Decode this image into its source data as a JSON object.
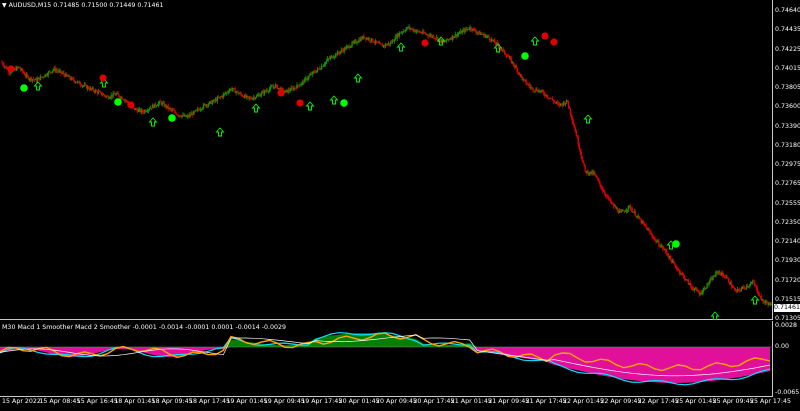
{
  "chart_title": "AUDUSD,M15  0.71485 0.71500 0.71449 0.71461",
  "indicator_title": "M30 Macd 1 Smoother Macd 2 Smoother -0.0001 -0.0014 -0.0001 0.0001 -0.0014 -0.0029",
  "price_axis": [
    "0.74640",
    "0.74435",
    "0.74225",
    "0.74015",
    "0.73805",
    "0.73600",
    "0.73390",
    "0.73180",
    "0.72975",
    "0.72765",
    "0.72555",
    "0.72350",
    "0.72140",
    "0.71930",
    "0.71720",
    "0.71515",
    "0.71305"
  ],
  "current_price": "0.71461",
  "indicator_axis": [
    "0.0028",
    "0.00",
    "-0.0065"
  ],
  "time_axis": [
    "15 Apr 2022",
    "15 Apr 08:45",
    "15 Apr 16:45",
    "18 Apr 01:45",
    "18 Apr 09:45",
    "18 Apr 17:45",
    "19 Apr 01:45",
    "19 Apr 09:45",
    "19 Apr 17:45",
    "20 Apr 01:45",
    "20 Apr 09:45",
    "20 Apr 17:45",
    "21 Apr 01:45",
    "21 Apr 09:45",
    "21 Apr 17:45",
    "22 Apr 01:45",
    "22 Apr 09:45",
    "22 Apr 17:45",
    "25 Apr 01:45",
    "25 Apr 09:45",
    "25 Apr 17:45"
  ],
  "colors": {
    "bull": "#00a000",
    "bear": "#e00000",
    "arrow": "#00ff00",
    "macd_fill_pos": "#008000",
    "macd_fill_neg": "#e0109a",
    "line1": "#ffa500",
    "line2": "#00e5ff",
    "line3": "#ffffff"
  },
  "chart_data": {
    "type": "line",
    "series": [
      {
        "values": [
          0.7409,
          0.7398,
          0.7403,
          0.7392,
          0.7389,
          0.7395,
          0.7401,
          0.7396,
          0.739,
          0.7385,
          0.738,
          0.7376,
          0.7371,
          0.7374,
          0.7368,
          0.7358,
          0.7355,
          0.736,
          0.7365,
          0.7358,
          0.7352,
          0.7349,
          0.7355,
          0.7362,
          0.7366,
          0.7372,
          0.738,
          0.7374,
          0.7369,
          0.7372,
          0.7378,
          0.7383,
          0.7376,
          0.738,
          0.7386,
          0.7395,
          0.7402,
          0.7412,
          0.7418,
          0.7424,
          0.743,
          0.7436,
          0.7432,
          0.7426,
          0.7429,
          0.744,
          0.7446,
          0.7442,
          0.7439,
          0.7436,
          0.743,
          0.7436,
          0.7441,
          0.7446,
          0.744,
          0.7436,
          0.7428,
          0.7418,
          0.7405,
          0.7389,
          0.738,
          0.7377,
          0.737,
          0.7362,
          0.7366,
          0.733,
          0.729,
          0.7288,
          0.727,
          0.7255,
          0.7245,
          0.7252,
          0.724,
          0.7228,
          0.7215,
          0.7205,
          0.719,
          0.7178,
          0.7165,
          0.7158,
          0.717,
          0.7182,
          0.7175,
          0.716,
          0.7165,
          0.717,
          0.715,
          0.7146
        ]
      }
    ],
    "ylim": [
      0.71305,
      0.7464
    ]
  },
  "signals": {
    "up_arrows": 15,
    "down_marks": 8
  }
}
